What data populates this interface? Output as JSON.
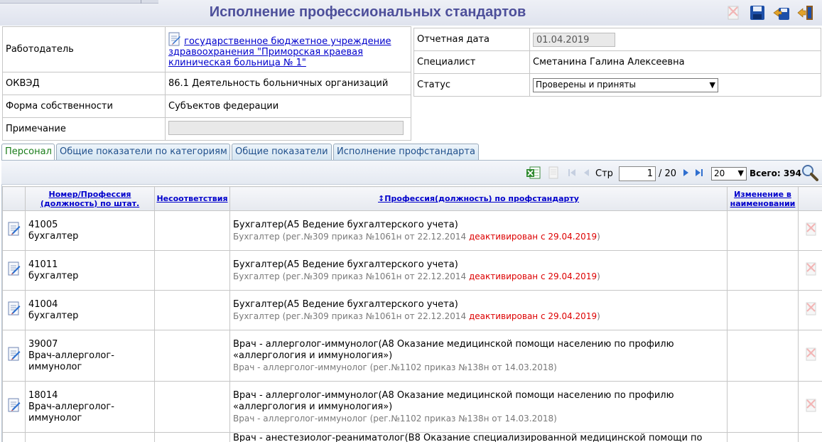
{
  "page": {
    "title": "Исполнение профессиональных стандартов"
  },
  "toolbar": {
    "icons": [
      "delete-doc-icon",
      "save-icon",
      "save-all-icon",
      "exit-icon"
    ]
  },
  "header_left": {
    "employer_label": "Работодатель",
    "employer_value": "государственное бюджетное учреждение здравоохранения \"Приморская краевая клиническая больница № 1\"",
    "okved_label": "ОКВЭД",
    "okved_value": "86.1 Деятельность больничных организаций",
    "ownership_label": "Форма собственности",
    "ownership_value": "Субъектов федерации",
    "note_label": "Примечание",
    "note_value": ""
  },
  "header_right": {
    "report_date_label": "Отчетная дата",
    "report_date_value": "01.04.2019",
    "specialist_label": "Специалист",
    "specialist_value": "Сметанина Галина Алексеевна",
    "status_label": "Статус",
    "status_value": "Проверены и приняты"
  },
  "tabs": [
    {
      "label": "Персонал",
      "active": true
    },
    {
      "label": "Общие показатели по категориям",
      "active": false
    },
    {
      "label": "Общие показатели",
      "active": false
    },
    {
      "label": "Исполнение профстандарта",
      "active": false
    }
  ],
  "pager": {
    "page_label": "Стр",
    "current_page": "1",
    "total_pages": "/ 20",
    "page_size": "20",
    "total_label": "Всего: 394"
  },
  "grid": {
    "columns": {
      "number": "Номер/Профессия (должность) по штат.",
      "mismatch": "Несоответствия",
      "profession": "↕Профессия(должность) по профстандарту",
      "name_change": "Изменение в наименовании"
    },
    "rows": [
      {
        "number": "41005",
        "position": "бухгалтер",
        "main": "Бухгалтер(A5 Ведение бухгалтерского учета)",
        "sub": "Бухгалтер (рег.№309 приказ №1061н от 22.12.2014 ",
        "deactivated": "деактивирован с 29.04.2019",
        "sub_end": ")"
      },
      {
        "number": "41011",
        "position": "бухгалтер",
        "main": "Бухгалтер(A5 Ведение бухгалтерского учета)",
        "sub": "Бухгалтер (рег.№309 приказ №1061н от 22.12.2014 ",
        "deactivated": "деактивирован с 29.04.2019",
        "sub_end": ")"
      },
      {
        "number": "41004",
        "position": "бухгалтер",
        "main": "Бухгалтер(A5 Ведение бухгалтерского учета)",
        "sub": "Бухгалтер (рег.№309 приказ №1061н от 22.12.2014 ",
        "deactivated": "деактивирован с 29.04.2019",
        "sub_end": ")"
      },
      {
        "number": "39007",
        "position": "Врач-аллерголог-иммунолог",
        "main": "Врач - аллерголог-иммунолог(A8 Оказание медицинской помощи населению по профилю «аллергология и иммунология»)",
        "sub": "Врач - аллерголог-иммунолог (рег.№1102 приказ №138н от 14.03.2018)",
        "deactivated": "",
        "sub_end": ""
      },
      {
        "number": "18014",
        "position": "Врач-аллерголог-иммунолог",
        "main": "Врач - аллерголог-иммунолог(A8 Оказание медицинской помощи населению по профилю «аллергология и иммунология»)",
        "sub": "Врач - аллерголог-иммунолог (рег.№1102 приказ №138н от 14.03.2018)",
        "deactivated": "",
        "sub_end": ""
      },
      {
        "number": "",
        "position": "",
        "main": "Врач - анестезиолог-реаниматолог(B8 Оказание специализированной медицинской помощи по",
        "sub": "",
        "deactivated": "",
        "sub_end": ""
      }
    ]
  }
}
